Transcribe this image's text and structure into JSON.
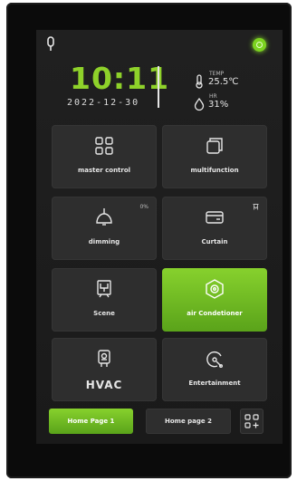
{
  "header": {
    "time": "10:11",
    "date": "2022-12-30",
    "temp_label": "TEMP",
    "temp_value": "25.5℃",
    "hr_label": "HR",
    "hr_value": "31%",
    "status_color": "#7cd320"
  },
  "tiles": [
    {
      "label": "master control",
      "icon": "four-squares-icon",
      "badge": ""
    },
    {
      "label": "multifunction",
      "icon": "stacked-cards-icon",
      "badge": ""
    },
    {
      "label": "dimming",
      "icon": "ceiling-lamp-icon",
      "badge": "0%"
    },
    {
      "label": "Curtain",
      "icon": "curtain-icon",
      "badge": ""
    },
    {
      "label": "Scene",
      "icon": "scene-icon",
      "badge": ""
    },
    {
      "label": "air Condetioner",
      "icon": "air-conditioner-icon",
      "badge": ""
    },
    {
      "label": "HVAC",
      "icon": "hvac-icon",
      "badge": ""
    },
    {
      "label": "Entertainment",
      "icon": "entertainment-icon",
      "badge": ""
    }
  ],
  "nav": {
    "page1": "Home Page 1",
    "page2": "Home page 2",
    "active_color": "#7cc926"
  }
}
